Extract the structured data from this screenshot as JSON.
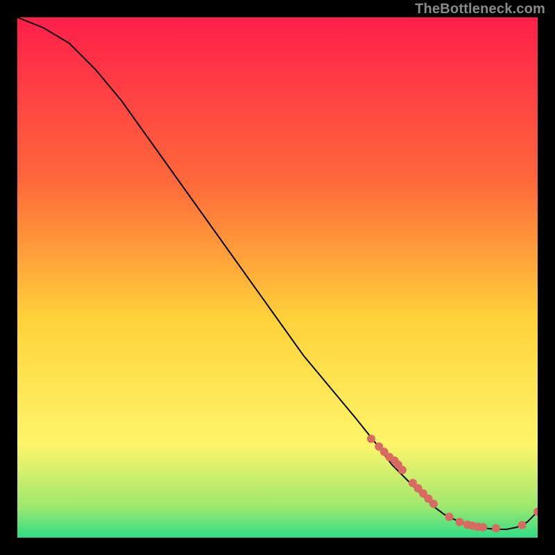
{
  "watermark": "TheBottleneck.com",
  "colors": {
    "gradient_top": "#ff1f4b",
    "gradient_mid1": "#ff6a3a",
    "gradient_mid2": "#ffd23a",
    "gradient_mid3": "#fff56a",
    "gradient_bottom1": "#9fe86f",
    "gradient_bottom2": "#2fdc85",
    "line": "#000000",
    "marker": "#d86a62"
  },
  "chart_data": {
    "type": "line",
    "title": "",
    "xlabel": "",
    "ylabel": "",
    "xlim": [
      0,
      100
    ],
    "ylim": [
      0,
      100
    ],
    "series": [
      {
        "name": "bottleneck-curve",
        "x": [
          0,
          5,
          10,
          15,
          20,
          25,
          30,
          35,
          40,
          45,
          50,
          55,
          60,
          65,
          69,
          72,
          75,
          78,
          80,
          82,
          84,
          86,
          88,
          90,
          92,
          94,
          96,
          98,
          100
        ],
        "y": [
          100,
          98,
          95,
          90,
          84,
          77,
          70,
          63,
          56,
          49,
          42,
          35,
          29,
          23,
          18,
          14,
          11,
          8,
          6,
          4.5,
          3.5,
          2.8,
          2.2,
          1.8,
          1.6,
          1.6,
          2.0,
          3.0,
          5.0
        ]
      }
    ],
    "markers": {
      "name": "highlighted-points",
      "x": [
        68,
        69.5,
        70.5,
        71.5,
        72.5,
        73.2,
        74,
        76,
        77,
        78,
        79,
        80,
        83,
        85,
        86.5,
        87.5,
        88.5,
        89.5,
        92,
        97,
        100
      ],
      "y": [
        19,
        17.5,
        16.5,
        15.5,
        14.8,
        14,
        13,
        10.5,
        9.5,
        8.5,
        7.5,
        6.5,
        4,
        3,
        2.5,
        2.3,
        2.1,
        2.0,
        1.8,
        2.4,
        5.0
      ]
    }
  }
}
